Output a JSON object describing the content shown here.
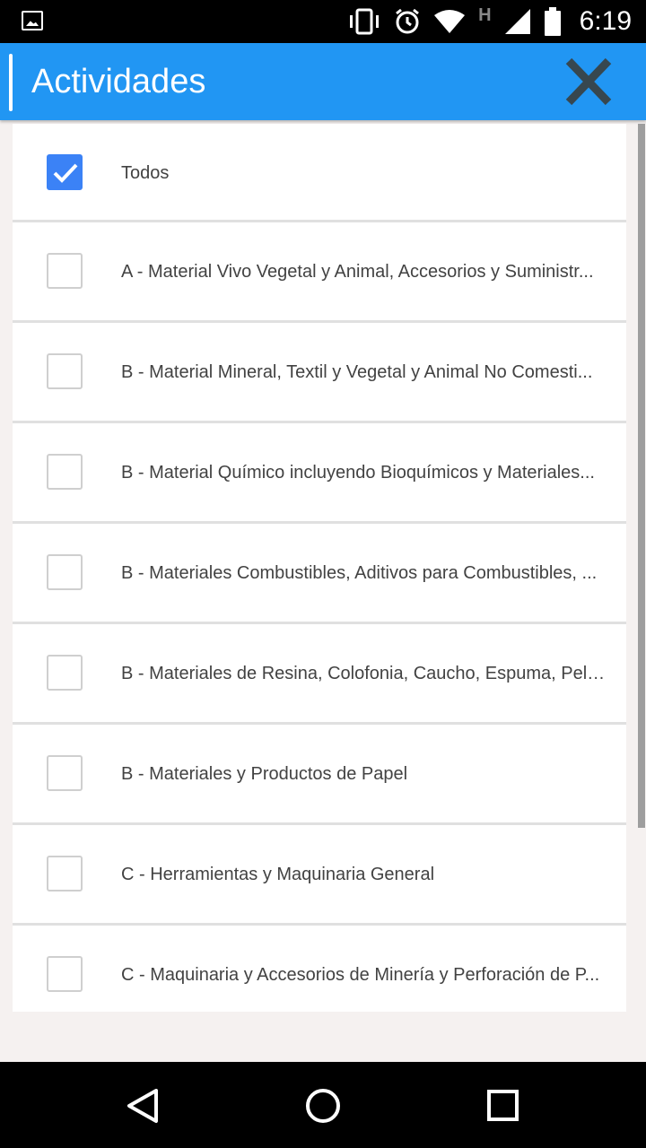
{
  "status_bar": {
    "time": "6:19",
    "network_label": "H"
  },
  "app_bar": {
    "title": "Actividades",
    "close_icon": "close-icon"
  },
  "items": [
    {
      "label": "Todos",
      "checked": true
    },
    {
      "label": "A - Material Vivo Vegetal y Animal, Accesorios y Suministr...",
      "checked": false
    },
    {
      "label": "B - Material Mineral, Textil y Vegetal y Animal No Comesti...",
      "checked": false
    },
    {
      "label": "B - Material Químico incluyendo Bioquímicos y Materiales...",
      "checked": false
    },
    {
      "label": "B - Materiales Combustibles, Aditivos para Combustibles, ...",
      "checked": false
    },
    {
      "label": "B - Materiales de Resina, Colofonia, Caucho, Espuma, Pelí...",
      "checked": false
    },
    {
      "label": "B - Materiales y Productos de Papel",
      "checked": false
    },
    {
      "label": "C - Herramientas y Maquinaria General",
      "checked": false
    },
    {
      "label": "C - Maquinaria y Accesorios de Minería y Perforación de P...",
      "checked": false
    }
  ],
  "nav_bar": {
    "back": "back-icon",
    "home": "home-icon",
    "recents": "recents-icon"
  },
  "colors": {
    "accent": "#2196f3",
    "checkbox_checked": "#3b82f6"
  }
}
